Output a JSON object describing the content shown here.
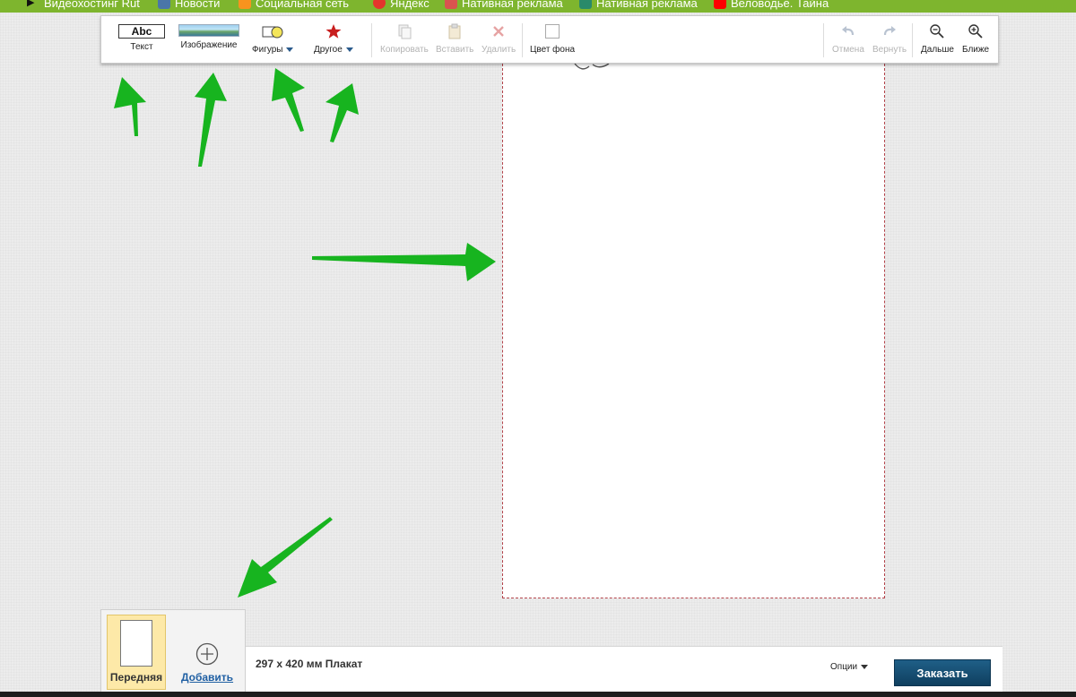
{
  "bookmarks": [
    {
      "label": "Видеохостинг Rut",
      "color": "#111111"
    },
    {
      "label": "Новости",
      "color": "#4a76a8"
    },
    {
      "label": "Социальная сеть",
      "color": "#f7931e"
    },
    {
      "label": "Яндекс",
      "color": "#e4352c"
    },
    {
      "label": "Нативная реклама",
      "color": "#d9534f"
    },
    {
      "label": "Нативная реклама",
      "color": "#2a8a6a"
    },
    {
      "label": "Веловодье. Тайна",
      "color": "#ff0000"
    }
  ],
  "toolbar": {
    "text": {
      "label": "Текст",
      "icon_text": "Abc"
    },
    "image": {
      "label": "Изображение"
    },
    "shapes": {
      "label": "Фигуры"
    },
    "other": {
      "label": "Другое"
    },
    "copy": {
      "label": "Копировать"
    },
    "paste": {
      "label": "Вставить"
    },
    "delete": {
      "label": "Удалить"
    },
    "bg_color": {
      "label": "Цвет фона"
    },
    "undo": {
      "label": "Отмена"
    },
    "redo": {
      "label": "Вернуть"
    },
    "zoom_out": {
      "label": "Дальше"
    },
    "zoom_in": {
      "label": "Ближе"
    }
  },
  "pages": {
    "front_label": "Передняя",
    "add_label": "Добавить"
  },
  "product": {
    "description": "297 x 420 мм Плакат"
  },
  "options_label": "Опции",
  "order_button": "Заказать",
  "colors": {
    "bookmarks_bar": "#7eb52e",
    "order_button": "#164c6e",
    "arrow": "#17b41f",
    "page_border": "#b3434a"
  }
}
